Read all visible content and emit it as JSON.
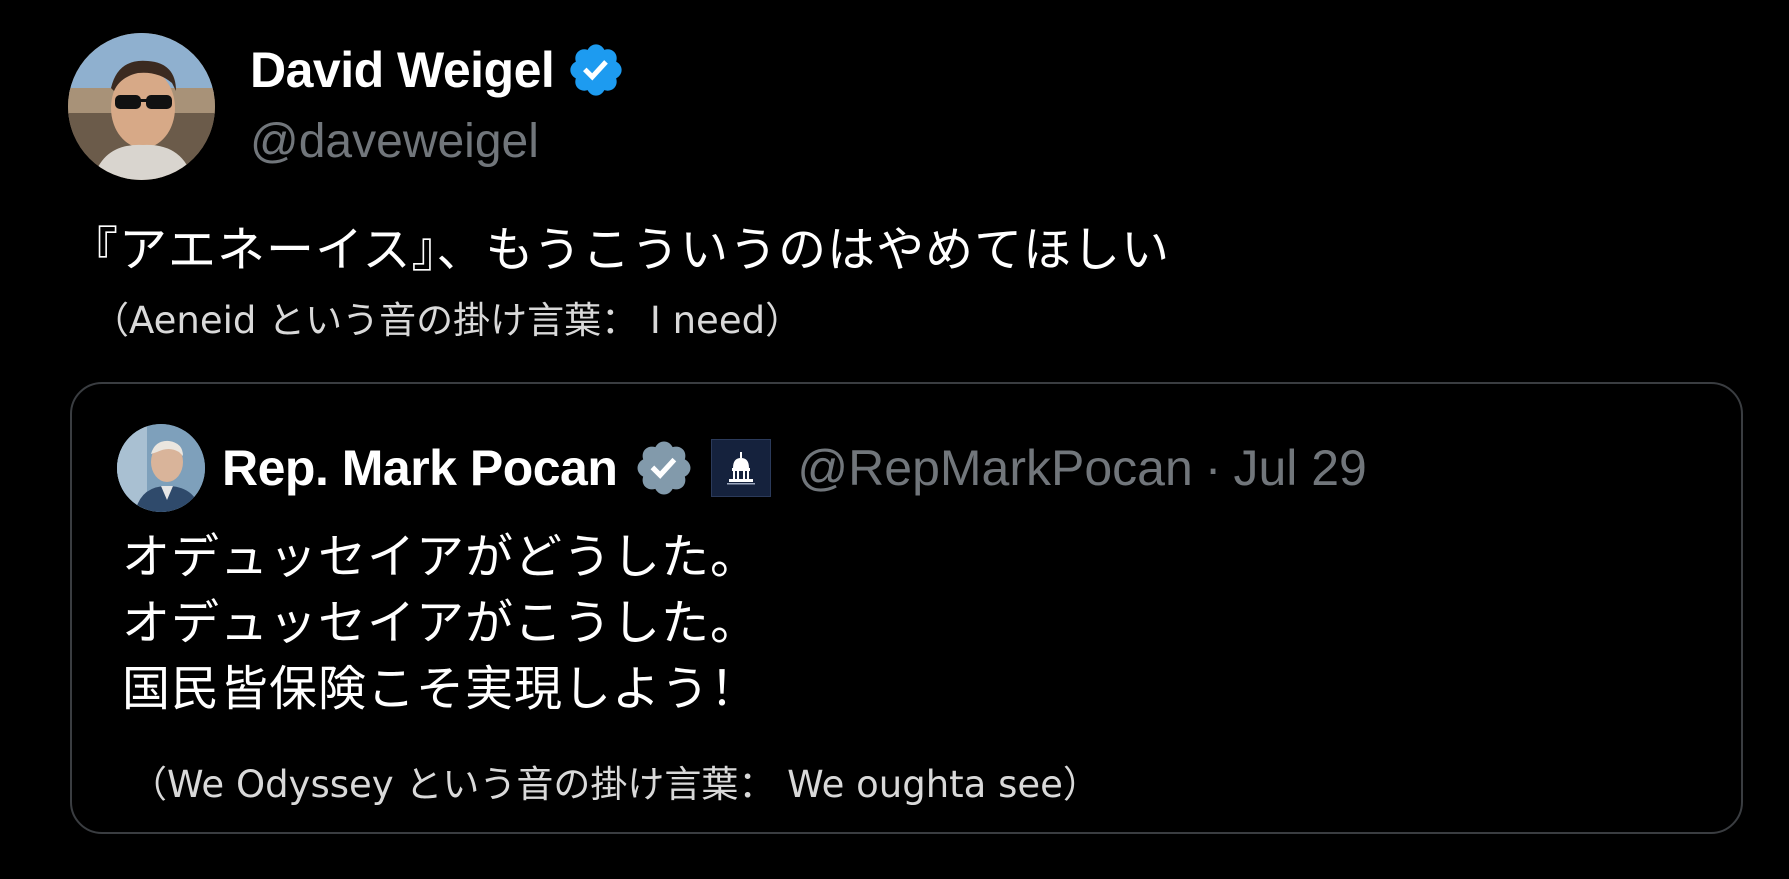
{
  "author": {
    "name": "David Weigel",
    "handle": "@daveweigel",
    "verified_color": "#1d9bf0",
    "avatar_icon": "person-sunglasses-avatar"
  },
  "tweet": {
    "text": "『アエネーイス』、もうこういうのはやめてほしい",
    "note": "（Aeneid という音の掛け言葉： I need）"
  },
  "quoted_tweet": {
    "name": "Rep. Mark Pocan",
    "handle": "@RepMarkPocan",
    "separator": "·",
    "date": "Jul 29",
    "verified_color": "#829aab",
    "affiliate_badge_icon": "us-capitol-icon",
    "lines": [
      "オデュッセイアがどうした。",
      "オデュッセイアがこうした。",
      "国民皆保険こそ実現しよう！"
    ],
    "note": "（We Odyssey という音の掛け言葉： We oughta see）"
  },
  "colors": {
    "background": "#000000",
    "text_primary": "#ffffff",
    "text_secondary": "#71767b",
    "card_border": "#3a3d41"
  }
}
